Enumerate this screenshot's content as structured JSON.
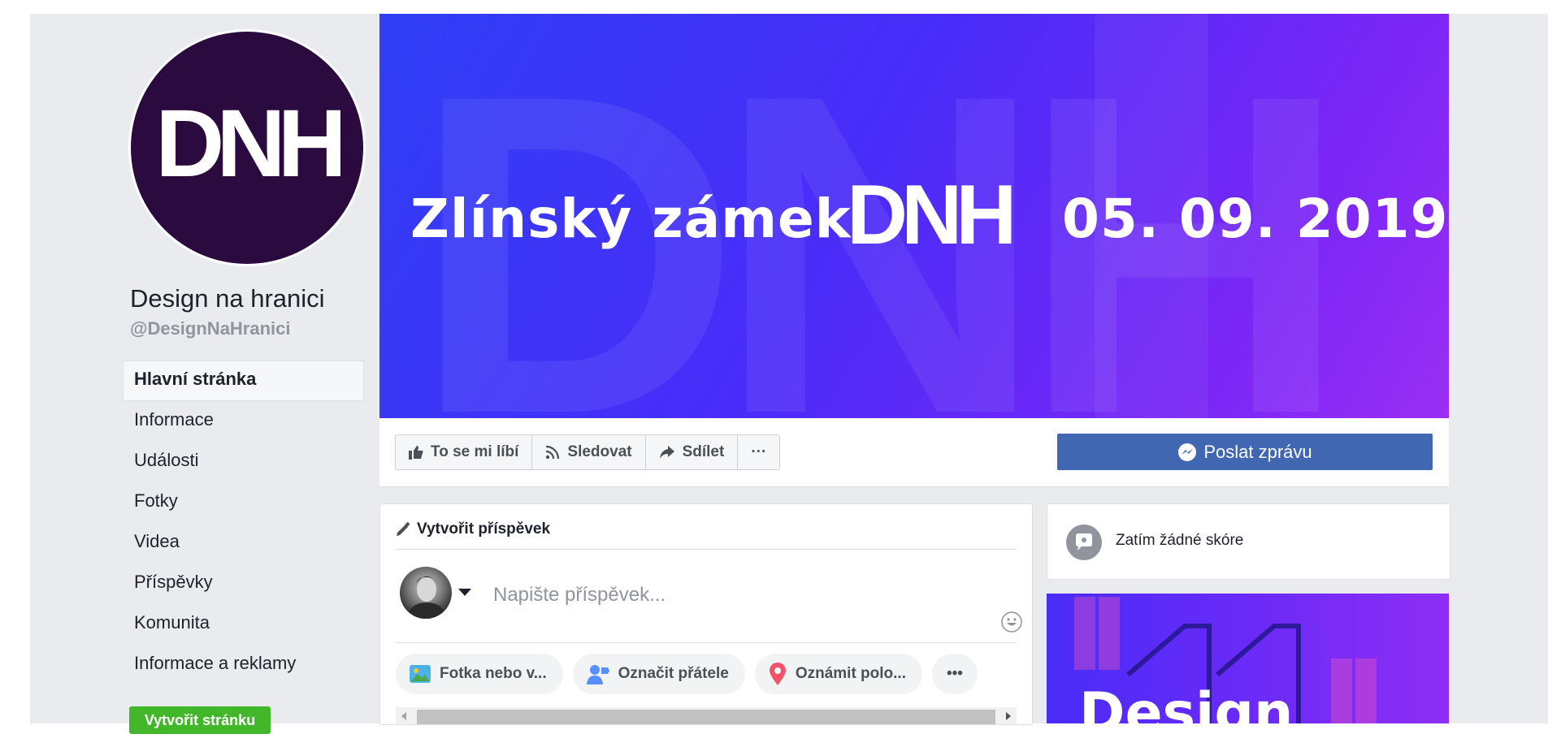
{
  "page": {
    "name": "Design na hranici",
    "handle": "@DesignNaHranici",
    "logo_text": "DNH"
  },
  "nav": {
    "items": [
      {
        "label": "Hlavní stránka",
        "active": true
      },
      {
        "label": "Informace"
      },
      {
        "label": "Události"
      },
      {
        "label": "Fotky"
      },
      {
        "label": "Videa"
      },
      {
        "label": "Příspěvky"
      },
      {
        "label": "Komunita"
      },
      {
        "label": "Informace a reklamy"
      }
    ],
    "create_page_label": "Vytvořit stránku"
  },
  "cover": {
    "place": "Zlínský zámek",
    "logo": "DNH",
    "date": "05. 09. 2019",
    "colors": {
      "start": "#2f3ff6",
      "end": "#9a2ff5"
    }
  },
  "actions": {
    "like": {
      "label": "To se mi líbí",
      "icon": "thumbs-up-icon"
    },
    "follow": {
      "label": "Sledovat",
      "icon": "rss-icon"
    },
    "share": {
      "label": "Sdílet",
      "icon": "share-arrow-icon"
    },
    "more": {
      "label": "···",
      "icon": "more-icon"
    },
    "message": {
      "label": "Poslat zprávu",
      "icon": "messenger-icon"
    }
  },
  "composer": {
    "title": "Vytvořit příspěvek",
    "placeholder": "Napište příspěvek...",
    "pills": [
      {
        "label": "Fotka nebo v...",
        "icon": "photo-icon"
      },
      {
        "label": "Označit přátele",
        "icon": "tag-friends-icon"
      },
      {
        "label": "Oznámit polo...",
        "icon": "location-pin-icon"
      }
    ],
    "more_label": "•••"
  },
  "score": {
    "text": "Zatím žádné skóre"
  },
  "promo": {
    "text": "Design"
  },
  "colors": {
    "accent": "#4267b2",
    "green": "#42b72a",
    "background": "#e9ebee"
  }
}
